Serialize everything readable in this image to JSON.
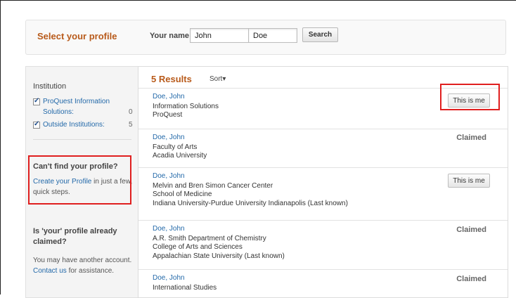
{
  "header": {
    "title": "Select your profile",
    "name_label": "Your name:",
    "first_name": "John",
    "last_name": "Doe",
    "search_label": "Search"
  },
  "sidebar": {
    "institution_heading": "Institution",
    "filters": [
      {
        "label_line1": "ProQuest Information",
        "label_line2": "Solutions:",
        "count": "0",
        "checked": true
      },
      {
        "label_line1": "Outside Institutions:",
        "count": "5",
        "checked": true
      }
    ],
    "cant_find_heading": "Can't find your profile?",
    "create_link": "Create your Profile",
    "create_rest_1": " in just a few,",
    "create_rest_2": "quick steps.",
    "claimed_heading_1": "Is 'your' profile already",
    "claimed_heading_2": "claimed?",
    "claimed_text": "You may have another account.",
    "contact_link": "Contact us",
    "contact_rest": " for assistance."
  },
  "results": {
    "count_label": "5 Results",
    "sort_label": "Sort▾",
    "items": [
      {
        "name": "Doe, John",
        "lines": [
          "Information Solutions",
          "ProQuest"
        ],
        "action": "This is me"
      },
      {
        "name": "Doe, John",
        "lines": [
          "Faculty of Arts",
          "Acadia University"
        ],
        "status": "Claimed"
      },
      {
        "name": "Doe, John",
        "lines": [
          "Melvin and Bren Simon Cancer Center",
          "School of Medicine",
          "Indiana University-Purdue University Indianapolis (Last known)"
        ],
        "action": "This is me"
      },
      {
        "name": "Doe, John",
        "lines": [
          "A.R. Smith Department of Chemistry",
          "College of Arts and Sciences",
          "Appalachian State University (Last known)"
        ],
        "status": "Claimed"
      },
      {
        "name": "Doe, John",
        "lines": [
          "International Studies"
        ],
        "status": "Claimed"
      }
    ]
  },
  "colors": {
    "accent": "#b85a1a",
    "link": "#2369a9",
    "highlight": "#e01f1f"
  }
}
